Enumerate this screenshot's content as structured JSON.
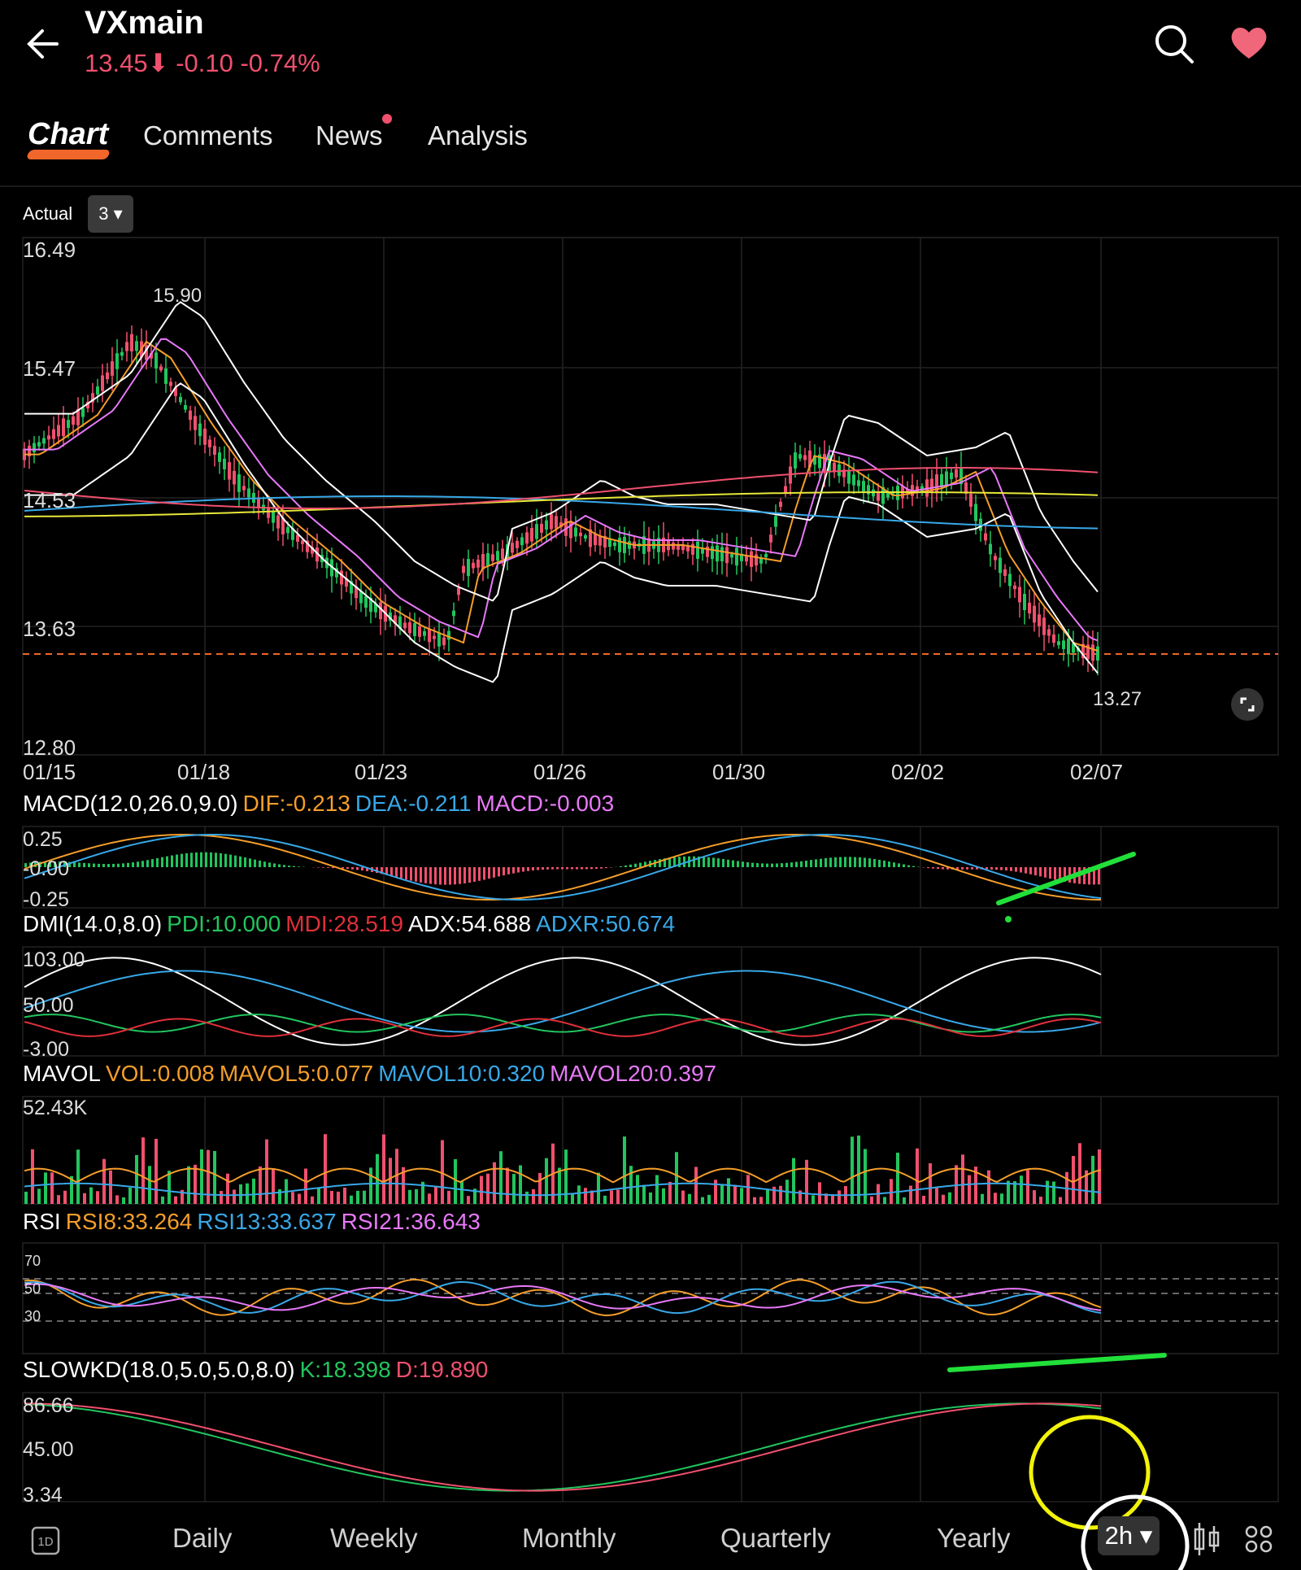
{
  "header": {
    "title": "VXmain",
    "price": "13.45",
    "change": "-0.10",
    "change_pct": "-0.74%"
  },
  "tabs": [
    "Chart",
    "Comments",
    "News",
    "Analysis"
  ],
  "adjust": {
    "label": "Actual",
    "value": "3"
  },
  "main_chart": {
    "y_ticks": [
      "16.49",
      "15.47",
      "14.53",
      "13.63",
      "12.80"
    ],
    "x_ticks": [
      "01/15",
      "01/18",
      "01/23",
      "01/26",
      "01/30",
      "02/02",
      "02/07"
    ],
    "high_label": "15.90",
    "low_label": "13.27"
  },
  "macd": {
    "name": "MACD(12.0,26.0,9.0)",
    "dif": "DIF:-0.213",
    "dea": "DEA:-0.211",
    "macd": "MACD:-0.003",
    "ticks": [
      "0.25",
      "-0.00",
      "-0.25"
    ]
  },
  "dmi": {
    "name": "DMI(14.0,8.0)",
    "pdi": "PDI:10.000",
    "mdi": "MDI:28.519",
    "adx": "ADX:54.688",
    "adxr": "ADXR:50.674",
    "ticks": [
      "103.00",
      "50.00",
      "-3.00"
    ]
  },
  "mavol": {
    "name": "MAVOL",
    "vol": "VOL:0.008",
    "mavol5": "MAVOL5:0.077",
    "mavol10": "MAVOL10:0.320",
    "mavol20": "MAVOL20:0.397",
    "ticks": [
      "52.43K"
    ]
  },
  "rsi": {
    "name": "RSI",
    "rsi8": "RSI8:33.264",
    "rsi13": "RSI13:33.637",
    "rsi21": "RSI21:36.643",
    "ticks": [
      "70",
      "50",
      "30"
    ]
  },
  "slowkd": {
    "name": "SLOWKD(18.0,5.0,5.0,8.0)",
    "k": "K:18.398",
    "d": "D:19.890",
    "ticks": [
      "86.66",
      "45.00",
      "3.34"
    ]
  },
  "bottom_bar": {
    "periods": [
      "Daily",
      "Weekly",
      "Monthly",
      "Quarterly",
      "Yearly"
    ],
    "selected": "2h"
  },
  "colors": {
    "up": "#22c55e",
    "down": "#f0506e",
    "dif": "#f59e2a",
    "dea": "#38a8e8",
    "macd": "#e879f9",
    "annotation_green": "#22e03a",
    "annotation_yellow": "#f2f20a"
  }
}
